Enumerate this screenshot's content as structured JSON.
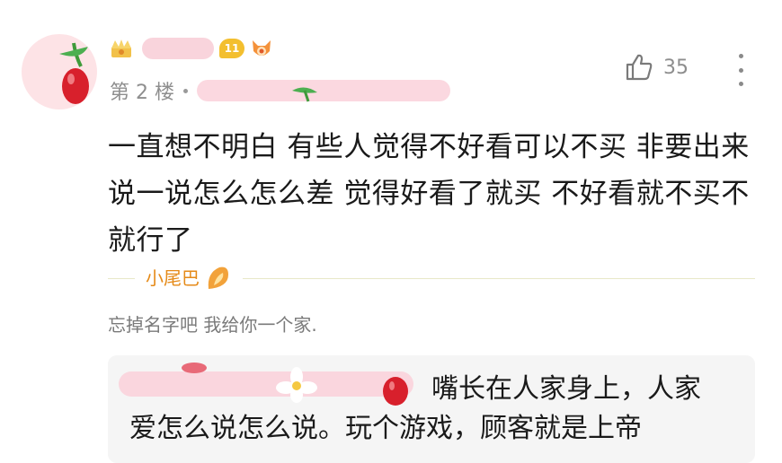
{
  "post": {
    "floor": "第 2 楼",
    "level": "11",
    "likes": "35",
    "content": "一直想不明白 有些人觉得不好看可以不买 非要出来说一说怎么怎么差 觉得好看了就买 不好看就不买不就行了"
  },
  "tail": {
    "label": "小尾巴",
    "signature": "忘掉名字吧 我给你一个家."
  },
  "reply": {
    "text_line1": "嘴长在人家身上，人家",
    "text_line2": "爱怎么说怎么说。玩个游戏，顾客就是上帝"
  },
  "colors": {
    "tail_accent": "#e58a18",
    "level_badge": "#f3bf2f",
    "blur_pink": "#f9d4dc"
  }
}
